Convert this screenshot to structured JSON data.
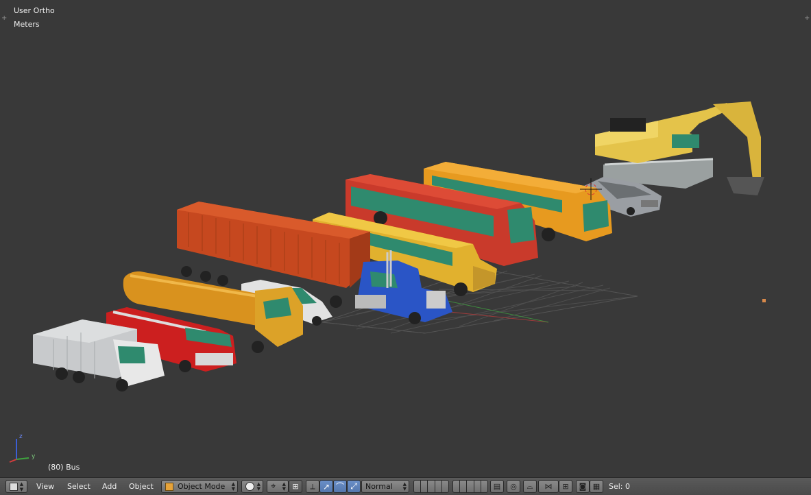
{
  "viewport": {
    "view_name": "User Ortho",
    "units": "Meters",
    "frame_object": "(80) Bus",
    "axis_labels": {
      "z": "z",
      "y": "y"
    }
  },
  "header": {
    "menus": {
      "view": "View",
      "select": "Select",
      "add": "Add",
      "object": "Object"
    },
    "mode": "Object Mode",
    "pivot": "Normal",
    "selection": "Sel: 0"
  },
  "icons": {
    "editor_type": "cube-icon",
    "viewport_shading": "solid-sphere-icon",
    "pivot": "pivot-icon",
    "manipulator": [
      "translate-icon",
      "rotate-icon",
      "scale-icon"
    ]
  },
  "colors": {
    "viewport_bg": "#393939",
    "header_bg": "#4f4f4f",
    "active_button": "#5a7fb8",
    "grid": "#4d4d4d",
    "axis_x": "#9b3b3b",
    "axis_y": "#3f8a3f"
  }
}
